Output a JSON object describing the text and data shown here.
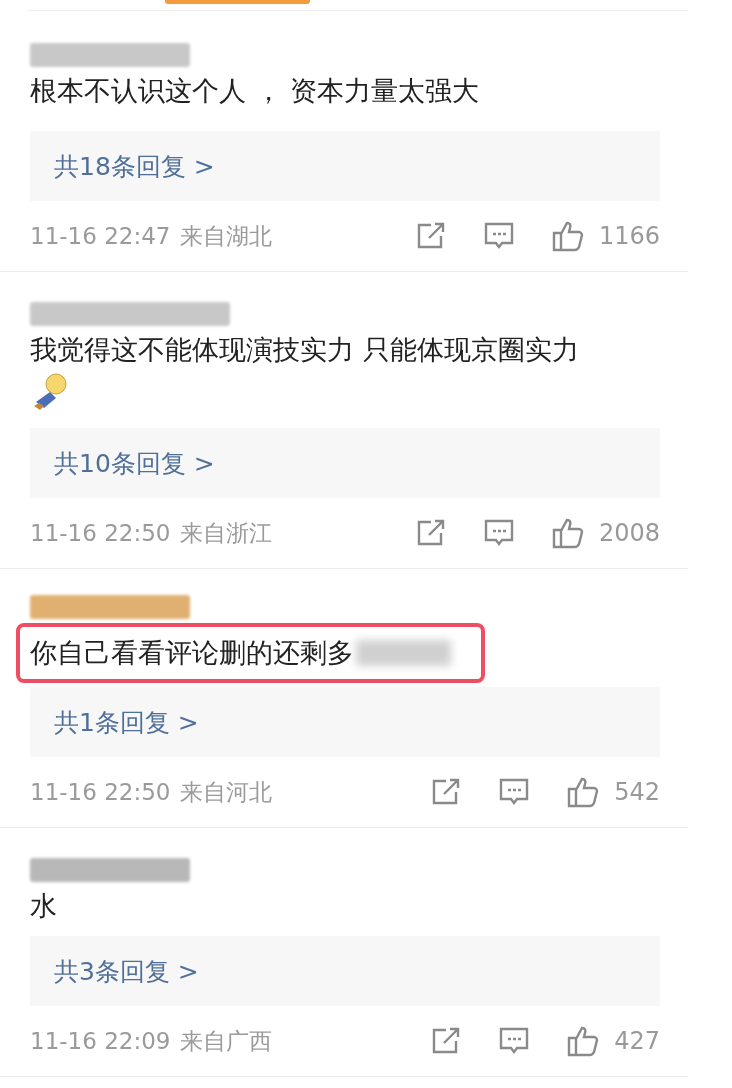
{
  "comments": [
    {
      "color": "#c8c8c8",
      "text": "根本不认识这个人 ， 资本力量太强大",
      "sticker": false,
      "highlighted": false,
      "text_blurred_tail": false,
      "replies": "共18条回复 >",
      "time": "11-16 22:47",
      "location": "来自湖北",
      "likes": "1166"
    },
    {
      "color": "#c8c8c8",
      "text": "我觉得这不能体现演技实力 只能体现京圈实力",
      "sticker": true,
      "highlighted": false,
      "text_blurred_tail": false,
      "replies": "共10条回复 >",
      "time": "11-16 22:50",
      "location": "来自浙江",
      "likes": "2008"
    },
    {
      "color": "#e0b070",
      "text": "你自己看看评论删的还剩多",
      "sticker": false,
      "highlighted": true,
      "text_blurred_tail": true,
      "replies": "共1条回复 >",
      "time": "11-16 22:50",
      "location": "来自河北",
      "likes": "542"
    },
    {
      "color": "#b8b8b8",
      "text": "水",
      "sticker": false,
      "highlighted": false,
      "text_blurred_tail": false,
      "replies": "共3条回复 >",
      "time": "11-16 22:09",
      "location": "来自广西",
      "likes": "427"
    }
  ]
}
